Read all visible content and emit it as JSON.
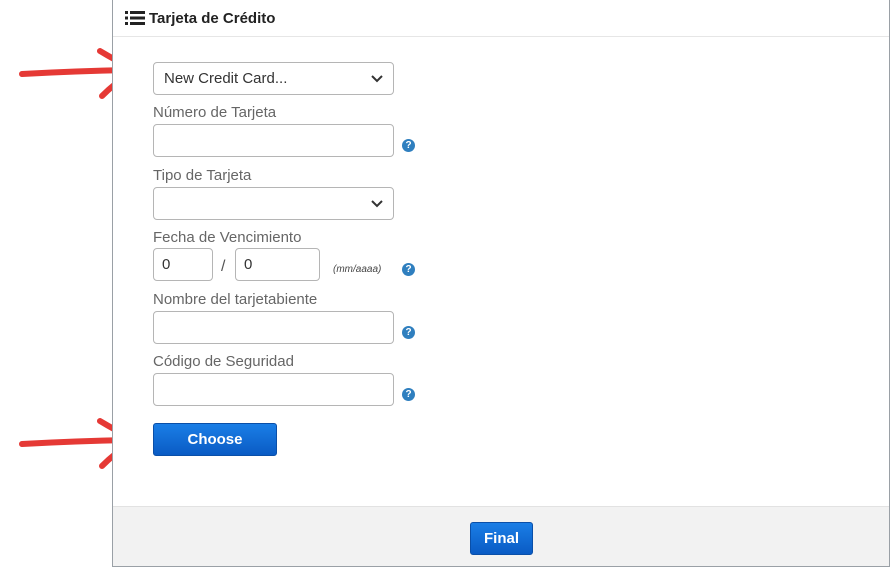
{
  "header": {
    "title": "Tarjeta de Crédito",
    "icon": "list-icon"
  },
  "card_select": {
    "selected": "New Credit Card..."
  },
  "fields": {
    "card_number": {
      "label": "Número de Tarjeta",
      "value": ""
    },
    "card_type": {
      "label": "Tipo de Tarjeta",
      "selected": ""
    },
    "expiry": {
      "label": "Fecha de Vencimiento",
      "month": "0",
      "separator": "/",
      "year": "0",
      "hint": "(mm/aaaa)"
    },
    "holder_name": {
      "label": "Nombre del tarjetabiente",
      "value": ""
    },
    "security_code": {
      "label": "Código de Seguridad",
      "value": ""
    }
  },
  "help_icon_glyph": "?",
  "buttons": {
    "choose": "Choose",
    "final": "Final"
  },
  "colors": {
    "accent": "#0a5bc4",
    "help": "#2f7fbf",
    "arrow": "#e53935"
  }
}
